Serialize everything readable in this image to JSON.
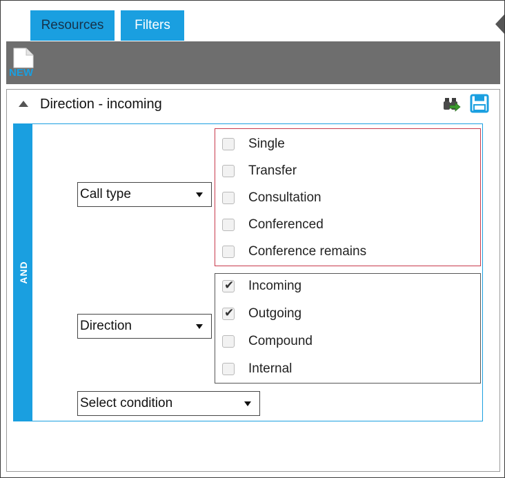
{
  "tabs": [
    {
      "label": "Resources",
      "active": false
    },
    {
      "label": "Filters",
      "active": true
    }
  ],
  "toolbar": {
    "new_icon_text": "NEW"
  },
  "panel": {
    "title": "Direction - incoming",
    "group_operator": "AND",
    "conditions": [
      {
        "field": "Call type",
        "options": [
          {
            "label": "Single",
            "checked": false
          },
          {
            "label": "Transfer",
            "checked": false
          },
          {
            "label": "Consultation",
            "checked": false
          },
          {
            "label": "Conferenced",
            "checked": false
          },
          {
            "label": "Conference remains",
            "checked": false
          }
        ]
      },
      {
        "field": "Direction",
        "options": [
          {
            "label": "Incoming",
            "checked": true
          },
          {
            "label": "Outgoing",
            "checked": true
          },
          {
            "label": "Compound",
            "checked": false
          },
          {
            "label": "Internal",
            "checked": false
          }
        ]
      }
    ],
    "add_condition_label": "Select condition"
  },
  "colors": {
    "accent": "#1a9fe0",
    "toolbar": "#6e6e6e",
    "invalid_border": "#c8384a",
    "binoculars": "#3a7d2c",
    "save": "#1a9fe0"
  }
}
